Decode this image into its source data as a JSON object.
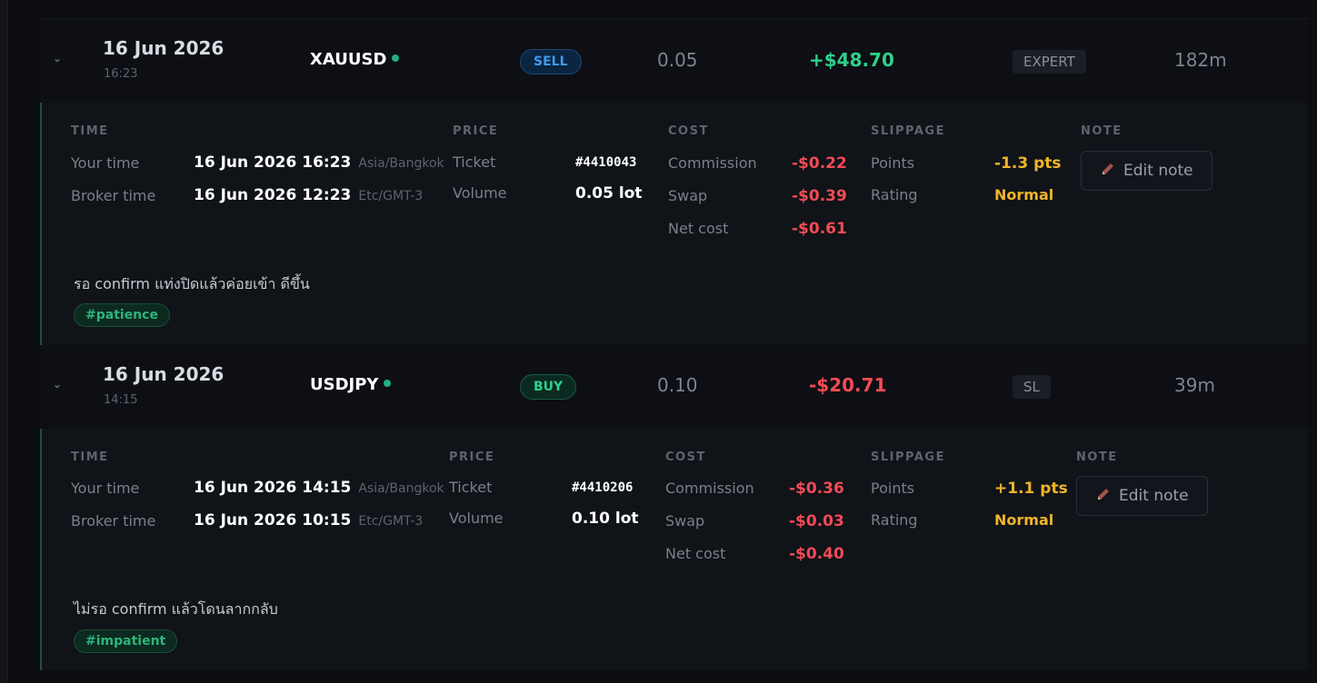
{
  "trades": [
    {
      "date": "16 Jun 2026",
      "time": "16:23",
      "symbol": "XAUUSD",
      "side": "SELL",
      "volume": "0.05",
      "pnl": "+$48.70",
      "reason": "EXPERT",
      "duration": "182m",
      "details": {
        "time_header": "TIME",
        "your_time_label": "Your time",
        "your_time_value": "16 Jun 2026 16:23",
        "your_tz": "Asia/Bangkok",
        "broker_time_label": "Broker time",
        "broker_time_value": "16 Jun 2026 12:23",
        "broker_tz": "Etc/GMT-3",
        "price_header": "PRICE",
        "ticket_label": "Ticket",
        "ticket_value": "#4410043",
        "volume_label": "Volume",
        "volume_value": "0.05 lot",
        "cost_header": "COST",
        "commission_label": "Commission",
        "commission_value": "-$0.22",
        "swap_label": "Swap",
        "swap_value": "-$0.39",
        "net_cost_label": "Net cost",
        "net_cost_value": "-$0.61",
        "slippage_header": "SLIPPAGE",
        "points_label": "Points",
        "points_value": "-1.3 pts",
        "rating_label": "Rating",
        "rating_value": "Normal",
        "note_header": "NOTE",
        "edit_note_label": "Edit note",
        "note_text": "รอ confirm แท่งปิดแล้วค่อยเข้า ดีขึ้น",
        "tag": "#patience"
      }
    },
    {
      "date": "16 Jun 2026",
      "time": "14:15",
      "symbol": "USDJPY",
      "side": "BUY",
      "volume": "0.10",
      "pnl": "-$20.71",
      "reason": "SL",
      "duration": "39m",
      "details": {
        "time_header": "TIME",
        "your_time_label": "Your time",
        "your_time_value": "16 Jun 2026 14:15",
        "your_tz": "Asia/Bangkok",
        "broker_time_label": "Broker time",
        "broker_time_value": "16 Jun 2026 10:15",
        "broker_tz": "Etc/GMT-3",
        "price_header": "PRICE",
        "ticket_label": "Ticket",
        "ticket_value": "#4410206",
        "volume_label": "Volume",
        "volume_value": "0.10 lot",
        "cost_header": "COST",
        "commission_label": "Commission",
        "commission_value": "-$0.36",
        "swap_label": "Swap",
        "swap_value": "-$0.03",
        "net_cost_label": "Net cost",
        "net_cost_value": "-$0.40",
        "slippage_header": "SLIPPAGE",
        "points_label": "Points",
        "points_value": "+1.1 pts",
        "rating_label": "Rating",
        "rating_value": "Normal",
        "note_header": "NOTE",
        "edit_note_label": "Edit note",
        "note_text": "ไม่รอ confirm แล้วโดนลากกลับ",
        "tag": "#impatient"
      }
    }
  ],
  "colors": {
    "profit": "#2fd08c",
    "loss": "#f24b55",
    "slippage": "#f0b429",
    "sell": "#3d9bf0",
    "buy": "#2fcf8c"
  },
  "icons": {
    "expand": "chevron-down-icon",
    "live": "status-dot-icon",
    "edit": "pencil-icon"
  }
}
